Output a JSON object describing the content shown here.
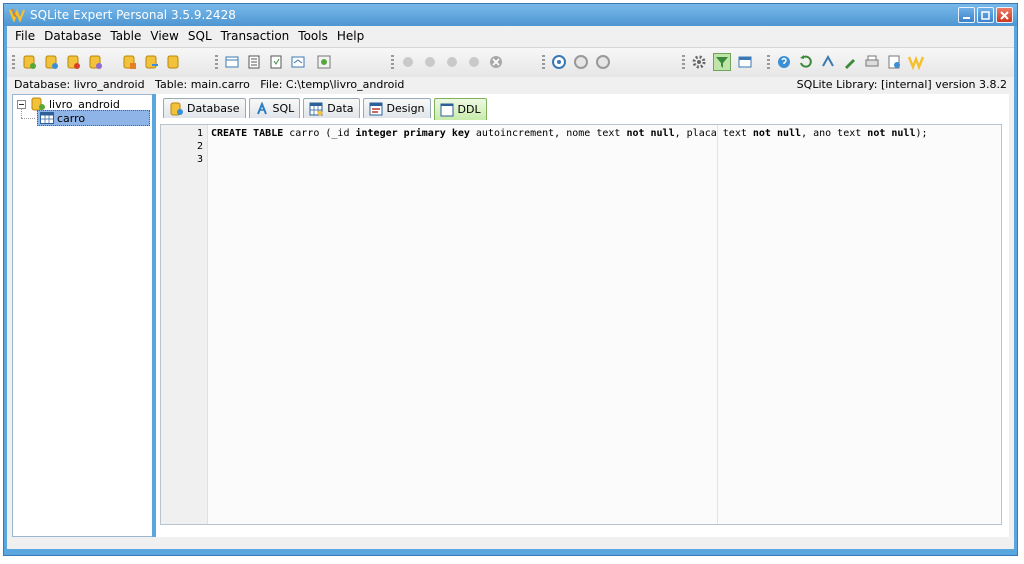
{
  "window": {
    "title": "SQLite Expert Personal 3.5.9.2428"
  },
  "menu": [
    {
      "label": "File"
    },
    {
      "label": "Database"
    },
    {
      "label": "Table"
    },
    {
      "label": "View"
    },
    {
      "label": "SQL"
    },
    {
      "label": "Transaction"
    },
    {
      "label": "Tools"
    },
    {
      "label": "Help"
    }
  ],
  "infobar": {
    "left": "Database: livro_android   Table: main.carro   File: C:\\temp\\livro_android",
    "right": "SQLite Library: [internal] version 3.8.2"
  },
  "tree": {
    "database": "livro_android",
    "table": "carro"
  },
  "tabs": [
    {
      "label": "Database",
      "icon": "database-icon"
    },
    {
      "label": "SQL",
      "icon": "sql-icon"
    },
    {
      "label": "Data",
      "icon": "data-grid-icon"
    },
    {
      "label": "Design",
      "icon": "design-icon"
    },
    {
      "label": "DDL",
      "icon": "ddl-icon",
      "active": true
    }
  ],
  "editor": {
    "line_numbers": [
      "1",
      "2",
      "3"
    ],
    "tokens": [
      {
        "t": "CREATE TABLE",
        "kw": true
      },
      {
        "t": " carro (_id ",
        "kw": false
      },
      {
        "t": "integer primary key",
        "kw": true
      },
      {
        "t": " autoincrement, nome text ",
        "kw": false
      },
      {
        "t": "not null",
        "kw": true
      },
      {
        "t": ", placa text ",
        "kw": false
      },
      {
        "t": "not null",
        "kw": true
      },
      {
        "t": ", ano text ",
        "kw": false
      },
      {
        "t": "not null",
        "kw": true
      },
      {
        "t": ");",
        "kw": false
      }
    ]
  },
  "colors": {
    "window_frame": "#5aa7df",
    "active_tab": "#c8ebab",
    "tree_selection": "#8fb5e8"
  }
}
